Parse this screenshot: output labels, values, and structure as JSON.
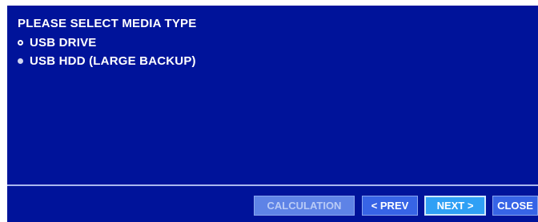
{
  "dialog": {
    "title": "PLEASE SELECT MEDIA TYPE",
    "options": [
      {
        "label": "USB DRIVE",
        "selected": false
      },
      {
        "label": "USB HDD (LARGE BACKUP)",
        "selected": true
      }
    ]
  },
  "buttons": {
    "calculation": "CALCULATION",
    "prev": "< PREV",
    "next": "NEXT >",
    "close": "CLOSE"
  },
  "colors": {
    "background": "#00139a",
    "button": "#3764e6",
    "button_disabled": "#5e83e6",
    "button_focused": "#2fa0f5"
  }
}
